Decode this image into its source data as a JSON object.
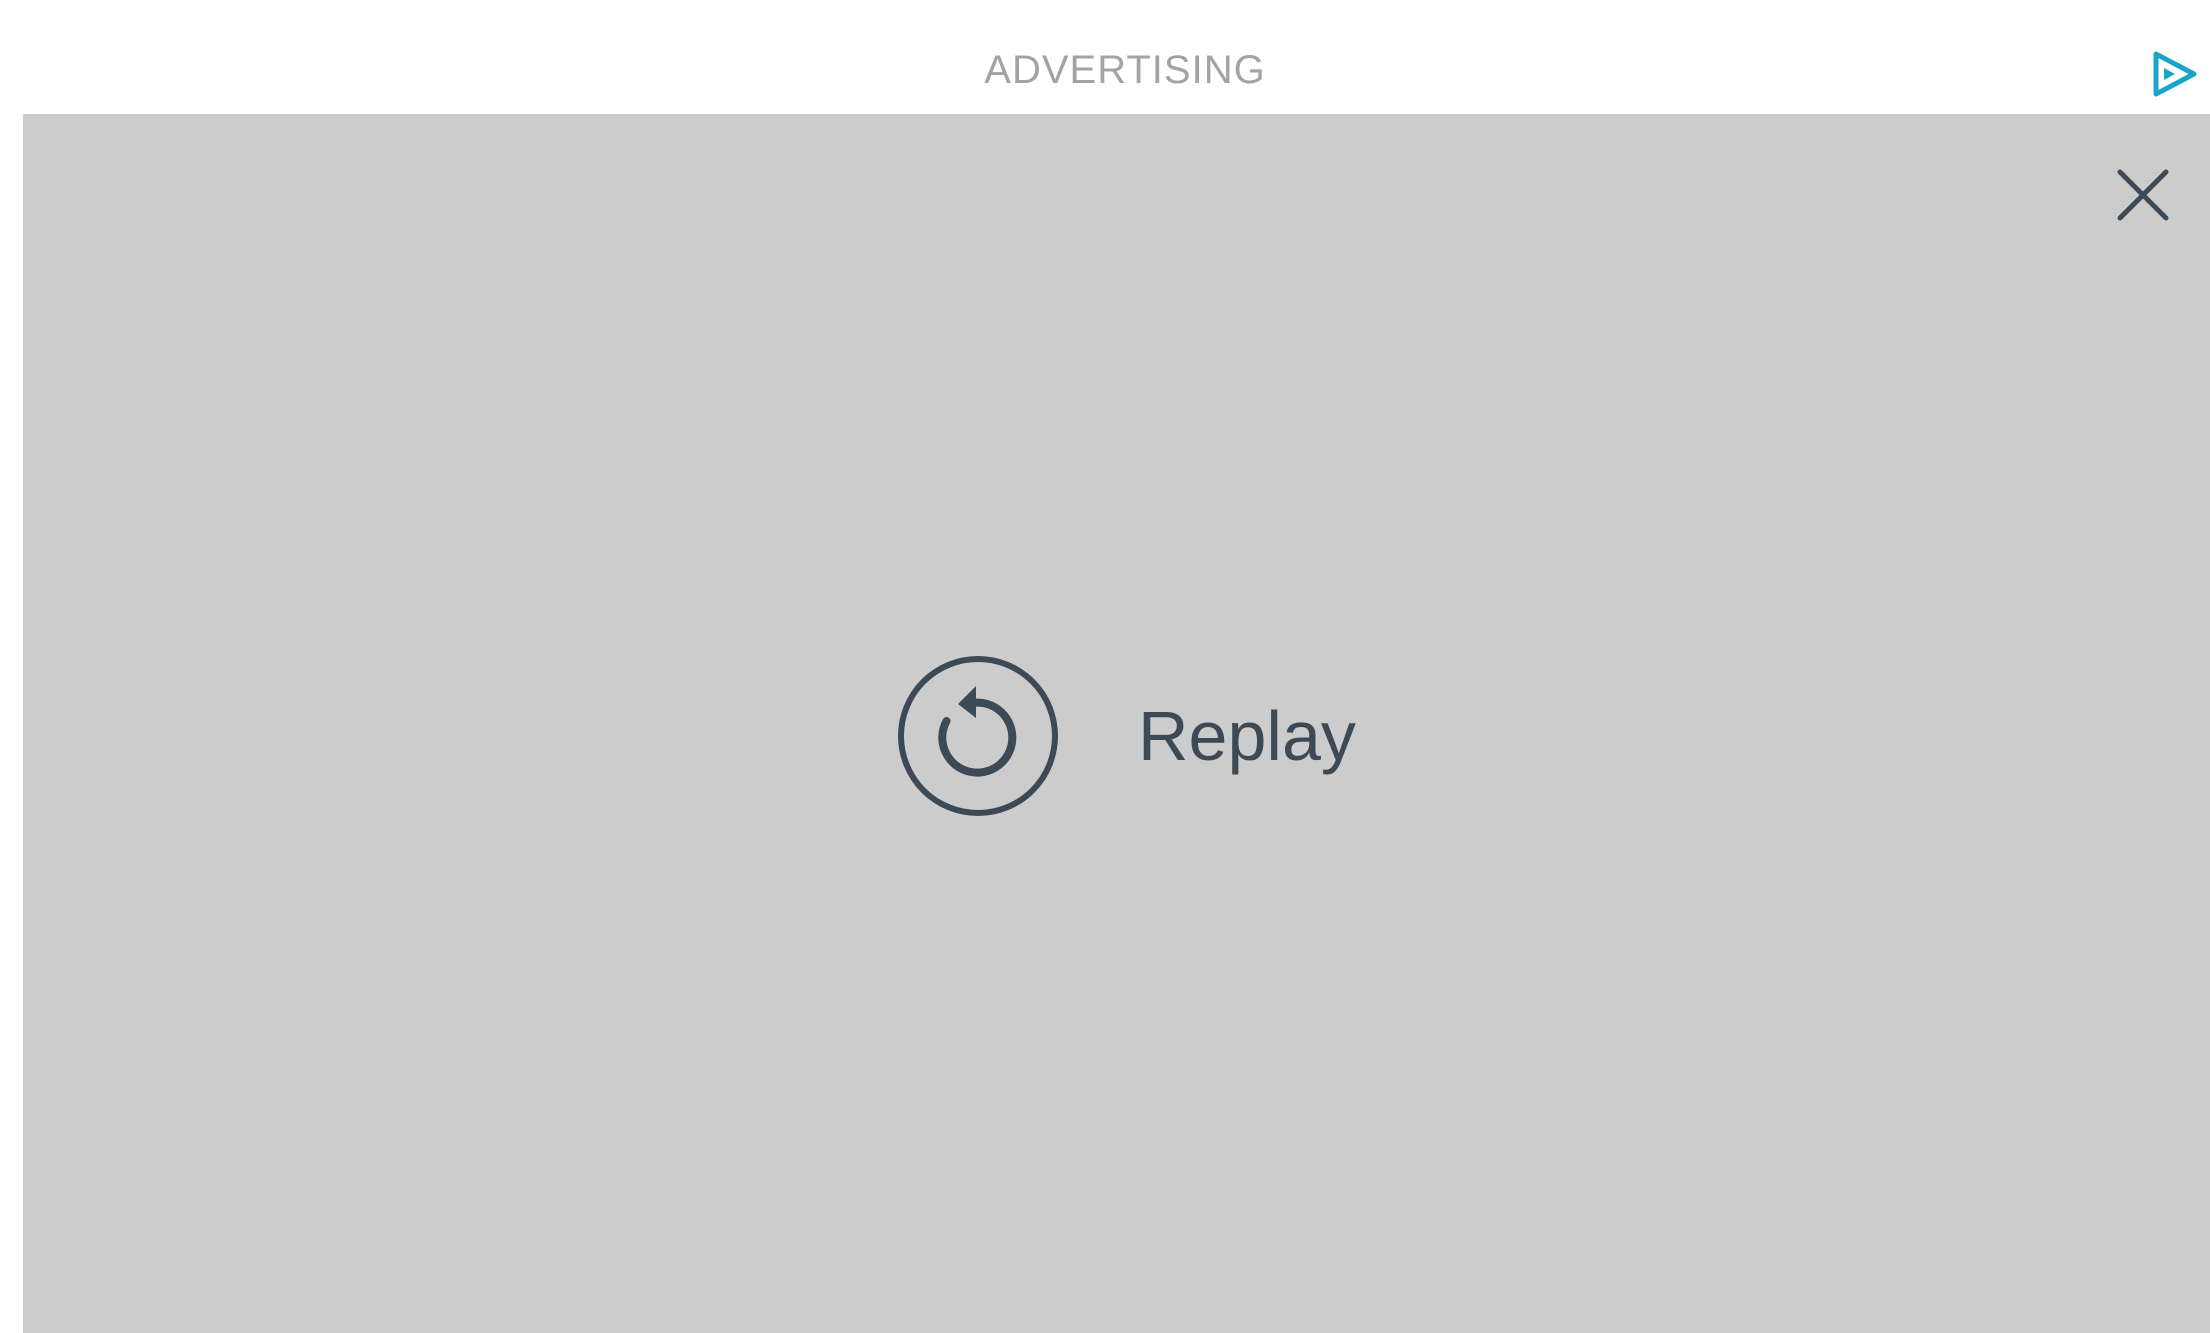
{
  "header": {
    "label": "ADVERTISING",
    "brand_icon": "play-triangle-icon",
    "brand_color": "#1aa5c8"
  },
  "player": {
    "background_color": "#cccccc",
    "close_icon": "close-icon",
    "replay": {
      "icon": "replay-icon",
      "label": "Replay",
      "color": "#3d4a55"
    }
  }
}
